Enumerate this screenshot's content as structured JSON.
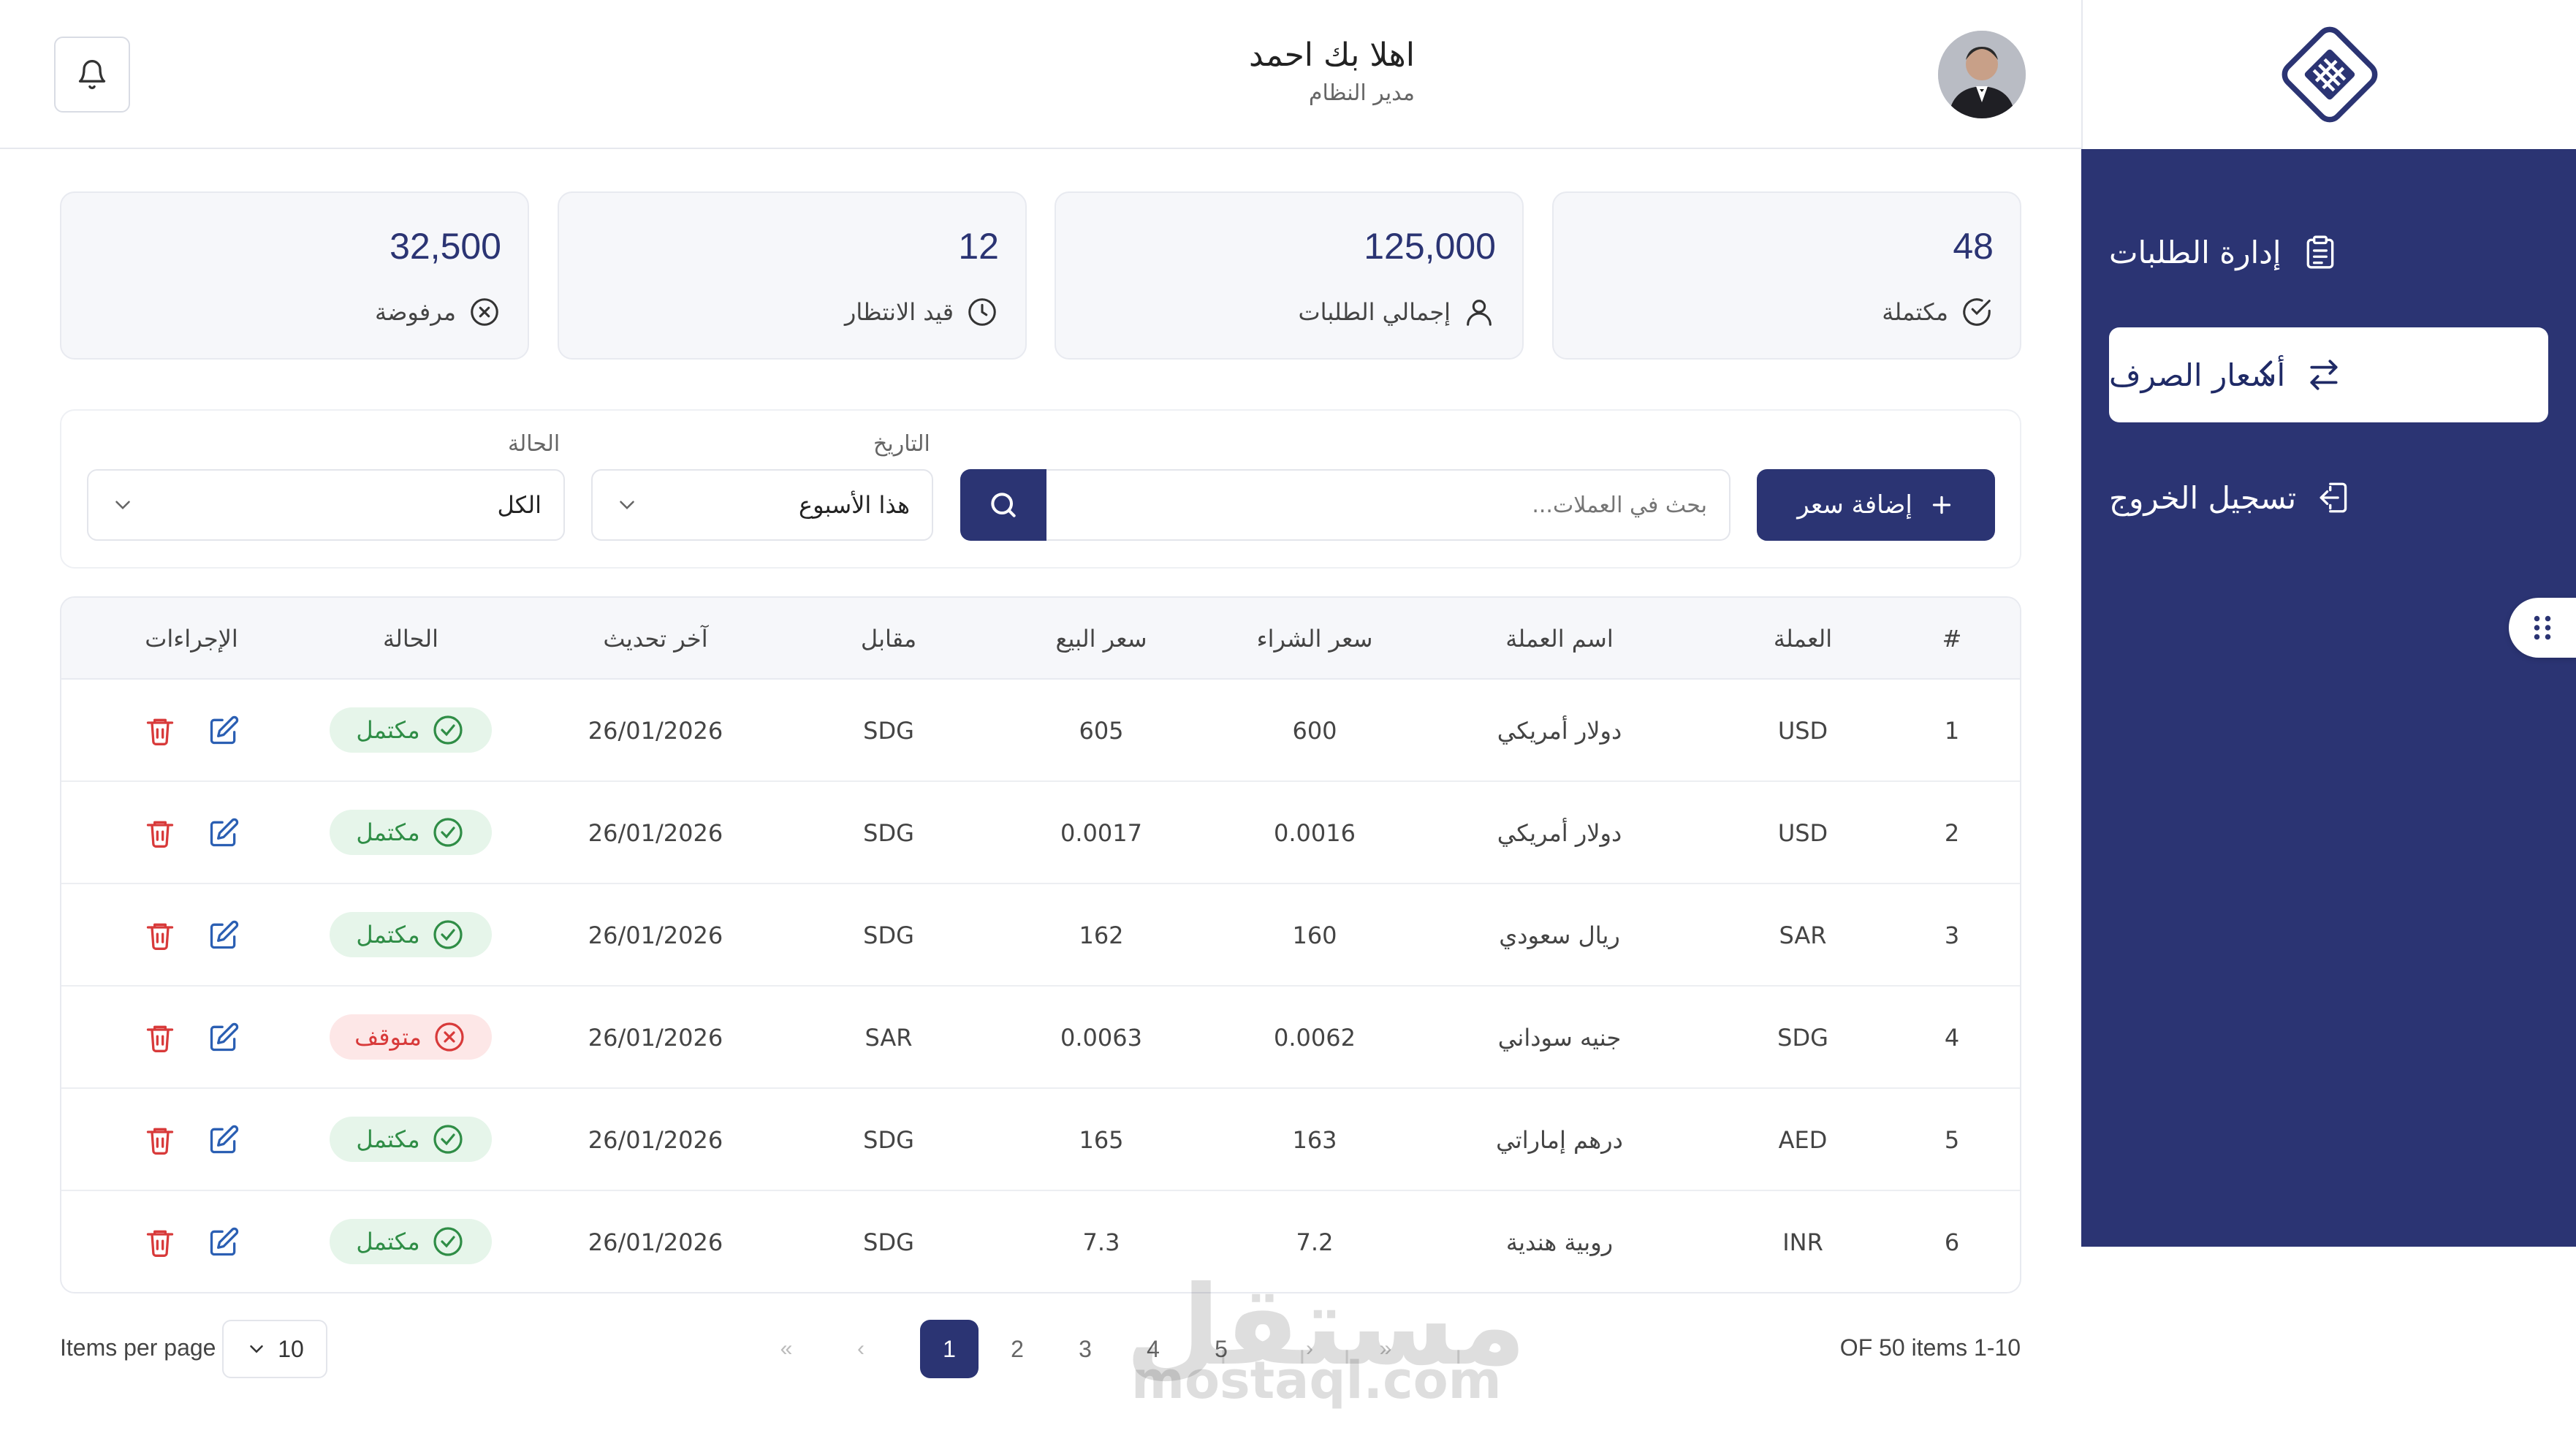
{
  "header": {
    "greeting": "اهلا بك احمد",
    "role": "مدير النظام"
  },
  "sidebar": {
    "items": [
      {
        "label": "إدارة الطلبات",
        "icon": "clipboard-icon"
      },
      {
        "label": "أسعار الصرف",
        "icon": "exchange-icon",
        "active": true
      },
      {
        "label": "تسجيل الخروج",
        "icon": "logout-icon"
      }
    ]
  },
  "stats": [
    {
      "value": "48",
      "label": "مكتملة",
      "icon": "check-circle-icon"
    },
    {
      "value": "125,000",
      "label": "إجمالي الطلبات",
      "icon": "user-icon"
    },
    {
      "value": "12",
      "label": "قيد الانتظار",
      "icon": "clock-icon"
    },
    {
      "value": "32,500",
      "label": "مرفوضة",
      "icon": "x-circle-icon"
    }
  ],
  "toolbar": {
    "add_label": "إضافة سعر",
    "search_placeholder": "بحث في العملات...",
    "date_label": "التاريخ",
    "date_value": "هذا الأسبوع",
    "status_label": "الحالة",
    "status_value": "الكل"
  },
  "table": {
    "headers": [
      "#",
      "العملة",
      "اسم العملة",
      "سعر الشراء",
      "سعر البيع",
      "مقابل",
      "آخر تحديث",
      "الحالة",
      "الإجراءات"
    ],
    "rows": [
      {
        "num": "1",
        "code": "USD",
        "name": "دولار أمريكي",
        "buy": "600",
        "sell": "605",
        "against": "SDG",
        "updated": "26/01/2026",
        "status": "مكتمل",
        "ok": true
      },
      {
        "num": "2",
        "code": "USD",
        "name": "دولار أمريكي",
        "buy": "0.0016",
        "sell": "0.0017",
        "against": "SDG",
        "updated": "26/01/2026",
        "status": "مكتمل",
        "ok": true
      },
      {
        "num": "3",
        "code": "SAR",
        "name": "ريال سعودي",
        "buy": "160",
        "sell": "162",
        "against": "SDG",
        "updated": "26/01/2026",
        "status": "مكتمل",
        "ok": true
      },
      {
        "num": "4",
        "code": "SDG",
        "name": "جنيه سوداني",
        "buy": "0.0062",
        "sell": "0.0063",
        "against": "SAR",
        "updated": "26/01/2026",
        "status": "متوقف",
        "ok": false
      },
      {
        "num": "5",
        "code": "AED",
        "name": "درهم إماراتي",
        "buy": "163",
        "sell": "165",
        "against": "SDG",
        "updated": "26/01/2026",
        "status": "مكتمل",
        "ok": true
      },
      {
        "num": "6",
        "code": "INR",
        "name": "روبية هندية",
        "buy": "7.2",
        "sell": "7.3",
        "against": "SDG",
        "updated": "26/01/2026",
        "status": "مكتمل",
        "ok": true
      }
    ]
  },
  "pagination": {
    "items_per_page_label": "Items per page",
    "items_per_page": "10",
    "first": "«",
    "prev": "‹",
    "pages": [
      "1",
      "2",
      "3",
      "4",
      "5"
    ],
    "current": "1",
    "next": "›",
    "last": "»",
    "range": "OF 50 items 1-10"
  },
  "watermark": {
    "arabic": "مستقل",
    "latin": "mostaql.com"
  },
  "colors": {
    "primary": "#2b3473",
    "success": "#2f8d46",
    "danger": "#d83a3a",
    "edit": "#2b5fb3"
  }
}
